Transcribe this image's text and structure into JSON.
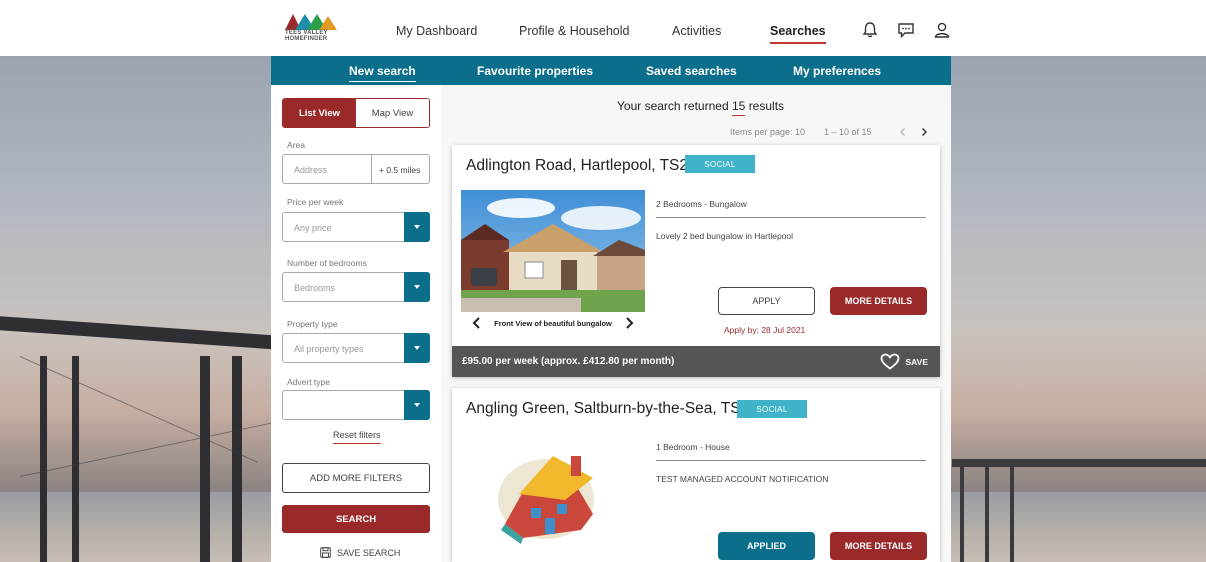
{
  "brand": {
    "line1": "TEES VALLEY",
    "line2": "HOMEFINDER"
  },
  "nav": {
    "items": [
      {
        "label": "My Dashboard"
      },
      {
        "label": "Profile & Household"
      },
      {
        "label": "Activities"
      },
      {
        "label": "Searches"
      }
    ],
    "active": "Searches",
    "icons": [
      "bell-icon",
      "chat-icon",
      "user-icon"
    ]
  },
  "subnav": {
    "items": [
      {
        "label": "New search"
      },
      {
        "label": "Favourite properties"
      },
      {
        "label": "Saved searches"
      },
      {
        "label": "My preferences"
      }
    ],
    "active": "New search"
  },
  "filters": {
    "view_list": "List View",
    "view_map": "Map View",
    "area_label": "Area",
    "address_placeholder": "Address",
    "radius": "+ 0.5 miles",
    "price_label": "Price per week",
    "price_value": "Any price",
    "bedrooms_label": "Number of bedrooms",
    "bedrooms_value": "Bedrooms",
    "type_label": "Property type",
    "type_value": "All property types",
    "advert_label": "Advert type",
    "advert_value": "",
    "reset": "Reset filters",
    "add_more": "ADD MORE FILTERS",
    "search": "SEARCH",
    "save_search": "SAVE SEARCH"
  },
  "results": {
    "prefix": "Your search returned",
    "count": "15",
    "suffix": "results",
    "items_per_page_label": "Items per page:",
    "items_per_page": "10",
    "range": "1 – 10 of 15"
  },
  "listings": [
    {
      "title": "Adlington Road, Hartlepool, TS24",
      "badge": "SOCIAL",
      "summary": "2 Bedrooms - Bungalow",
      "description": "Lovely 2 bed bungalow in Hartlepool",
      "apply_label": "APPLY",
      "more_label": "MORE DETAILS",
      "apply_by": "Apply by: 28 Jul 2021",
      "caption": "Front View of beautiful bungalow",
      "price": "£95.00 per week (approx. £412.80 per month)",
      "save_label": "SAVE"
    },
    {
      "title": "Angling Green, Saltburn-by-the-Sea, TS13",
      "badge": "SOCIAL",
      "summary": "1 Bedroom - House",
      "description": "TEST MANAGED ACCOUNT NOTIFICATION",
      "apply_label": "APPLIED",
      "more_label": "MORE DETAILS"
    }
  ],
  "colors": {
    "teal": "#0b6f8b",
    "maroon": "#9a2a2a",
    "badge": "#3fb3c8",
    "accent_red": "#c0392b"
  }
}
